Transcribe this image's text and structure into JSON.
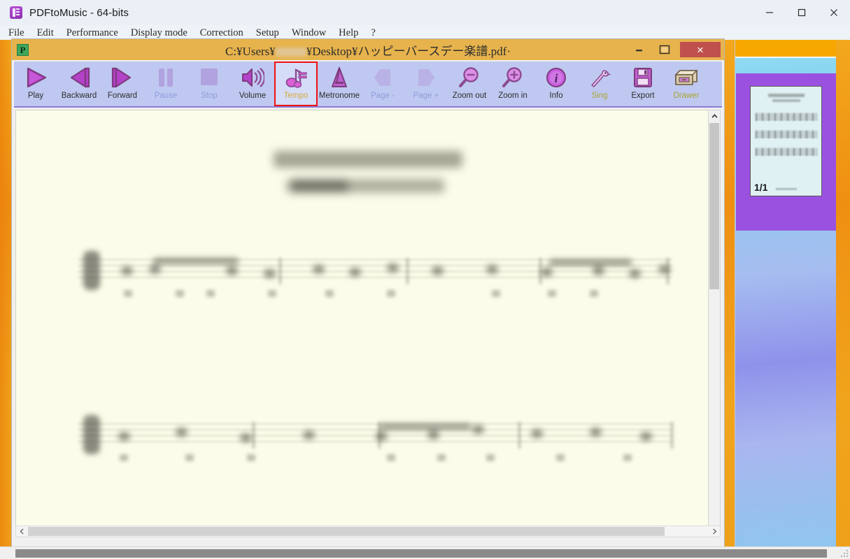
{
  "window": {
    "title": "PDFtoMusic - 64-bits",
    "app_icon": "pdftomusic-icon",
    "controls": {
      "minimize": "minimize-icon",
      "maximize": "maximize-icon",
      "close": "close-icon"
    }
  },
  "menubar": {
    "items": [
      {
        "label": "File"
      },
      {
        "label": "Edit"
      },
      {
        "label": "Performance"
      },
      {
        "label": "Display mode"
      },
      {
        "label": "Correction"
      },
      {
        "label": "Setup"
      },
      {
        "label": "Window"
      },
      {
        "label": "Help"
      },
      {
        "label": "?"
      }
    ]
  },
  "document_window": {
    "icon_letter": "P",
    "path_prefix": "C:¥Users¥",
    "path_suffix": "¥Desktop¥ハッピーバースデー楽譜.pdf·",
    "redacted_username": "",
    "controls": {
      "minimize": "minimize-icon",
      "maximize": "maximize-icon",
      "close_label": "×"
    }
  },
  "toolbar": {
    "buttons": [
      {
        "label": "Play",
        "icon": "play-icon",
        "state": "enabled"
      },
      {
        "label": "Backward",
        "icon": "backward-icon",
        "state": "enabled"
      },
      {
        "label": "Forward",
        "icon": "forward-icon",
        "state": "enabled"
      },
      {
        "label": "Pause",
        "icon": "pause-icon",
        "state": "disabled"
      },
      {
        "label": "Stop",
        "icon": "stop-icon",
        "state": "disabled"
      },
      {
        "label": "Volume",
        "icon": "volume-icon",
        "state": "enabled"
      },
      {
        "label": "Tempo",
        "icon": "tempo-icon",
        "state": "selected"
      },
      {
        "label": "Metronome",
        "icon": "metronome-icon",
        "state": "enabled"
      },
      {
        "label": "Page -",
        "icon": "page-prev-icon",
        "state": "disabled"
      },
      {
        "label": "Page +",
        "icon": "page-next-icon",
        "state": "disabled"
      },
      {
        "label": "Zoom out",
        "icon": "zoom-out-icon",
        "state": "enabled"
      },
      {
        "label": "Zoom in",
        "icon": "zoom-in-icon",
        "state": "enabled"
      },
      {
        "label": "Info",
        "icon": "info-icon",
        "state": "enabled"
      },
      {
        "label": "Sing",
        "icon": "sing-bird-icon",
        "state": "olive"
      },
      {
        "label": "Export",
        "icon": "export-floppy-icon",
        "state": "enabled"
      },
      {
        "label": "Drawer",
        "icon": "drawer-icon",
        "state": "olive"
      }
    ],
    "highlight_color": "#ee1111"
  },
  "thumbnails": {
    "selected_index": 0,
    "pages": [
      {
        "page_label": "1/1"
      }
    ]
  },
  "scrollbars": {
    "vertical": {
      "up": "chevron-up-icon",
      "down": "chevron-down-icon"
    },
    "horizontal": {
      "left": "chevron-left-icon",
      "right": "chevron-right-icon"
    }
  }
}
